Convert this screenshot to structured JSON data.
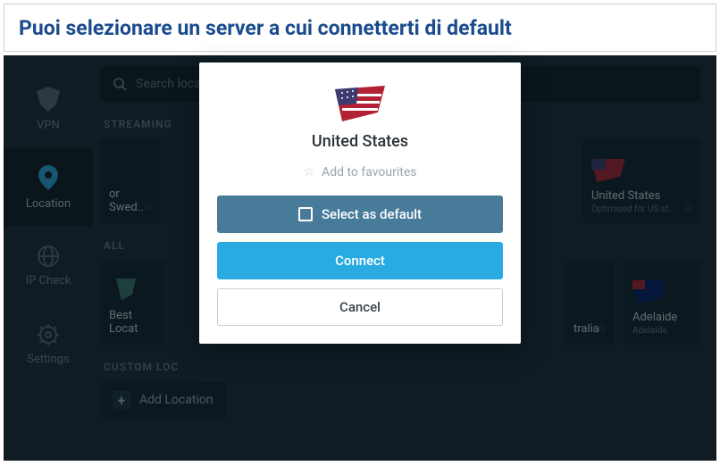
{
  "banner": {
    "text": "Puoi selezionare un server a cui connetterti di default"
  },
  "sidebar": {
    "items": [
      {
        "label": "VPN"
      },
      {
        "label": "Location"
      },
      {
        "label": "IP Check"
      },
      {
        "label": "Settings"
      }
    ]
  },
  "search": {
    "placeholder": "Search location"
  },
  "sections": {
    "streaming": "STREAMING",
    "all": "ALL",
    "custom": "CUSTOM LOC"
  },
  "cards": {
    "streaming_partial": "or Swed..",
    "us": {
      "title": "United States",
      "sub": "Optimised for US st.."
    },
    "best": "Best Locat",
    "australia_partial": "tralia",
    "adelaide": {
      "title": "Adelaide",
      "sub": "Adelaide"
    }
  },
  "addLocation": "Add Location",
  "modal": {
    "title": "United States",
    "favourites": "Add to favourites",
    "selectDefault": "Select as default",
    "connect": "Connect",
    "cancel": "Cancel"
  }
}
